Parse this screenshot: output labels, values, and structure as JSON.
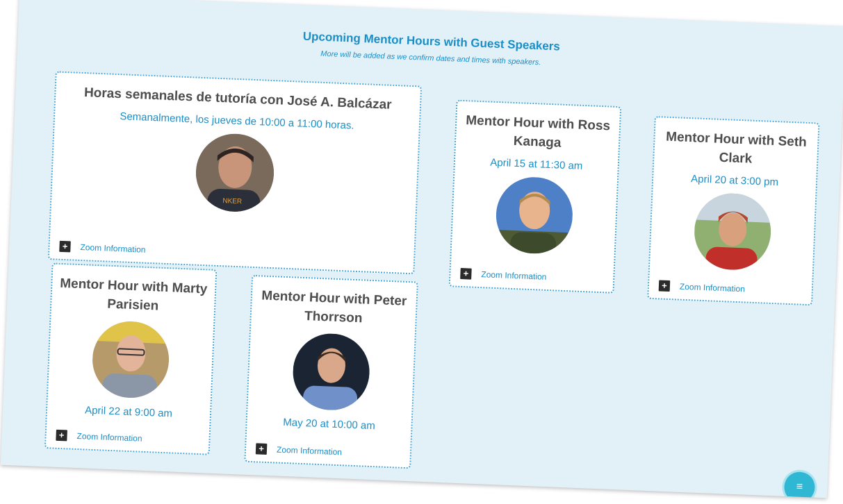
{
  "header": {
    "title": "Upcoming Mentor Hours with Guest Speakers",
    "subtitle": "More will be added as we confirm dates and times with speakers."
  },
  "cards": [
    {
      "title": "Horas semanales de tutoría con José A. Balcázar",
      "date": "Semanalmente, los jueves de 10:00 a 11:00 horas.",
      "zoom_label": "Zoom Information",
      "photo_bg": "#6f5a4a"
    },
    {
      "title": "Mentor Hour with Ross Kanaga",
      "date": "April 15 at 11:30 am",
      "zoom_label": "Zoom Information",
      "photo_bg": "#4d7fc2"
    },
    {
      "title": "Mentor Hour with Seth Clark",
      "date": "April 20 at 3:00 pm",
      "zoom_label": "Zoom Information",
      "photo_bg": "#8a6a4a"
    },
    {
      "title": "Mentor Hour with Marty Parisien",
      "date": "April 22 at 9:00 am",
      "zoom_label": "Zoom Information",
      "photo_bg": "#a58b62"
    },
    {
      "title": "Mentor Hour with Peter Thorrson",
      "date": "May 20 at 10:00 am",
      "zoom_label": "Zoom Information",
      "photo_bg": "#1f2a3a"
    }
  ],
  "icons": {
    "expand": "+",
    "chat": "≡"
  },
  "colors": {
    "accent": "#1a8fc7",
    "background": "#e2f0f8",
    "card_border": "#4aa6d6"
  }
}
